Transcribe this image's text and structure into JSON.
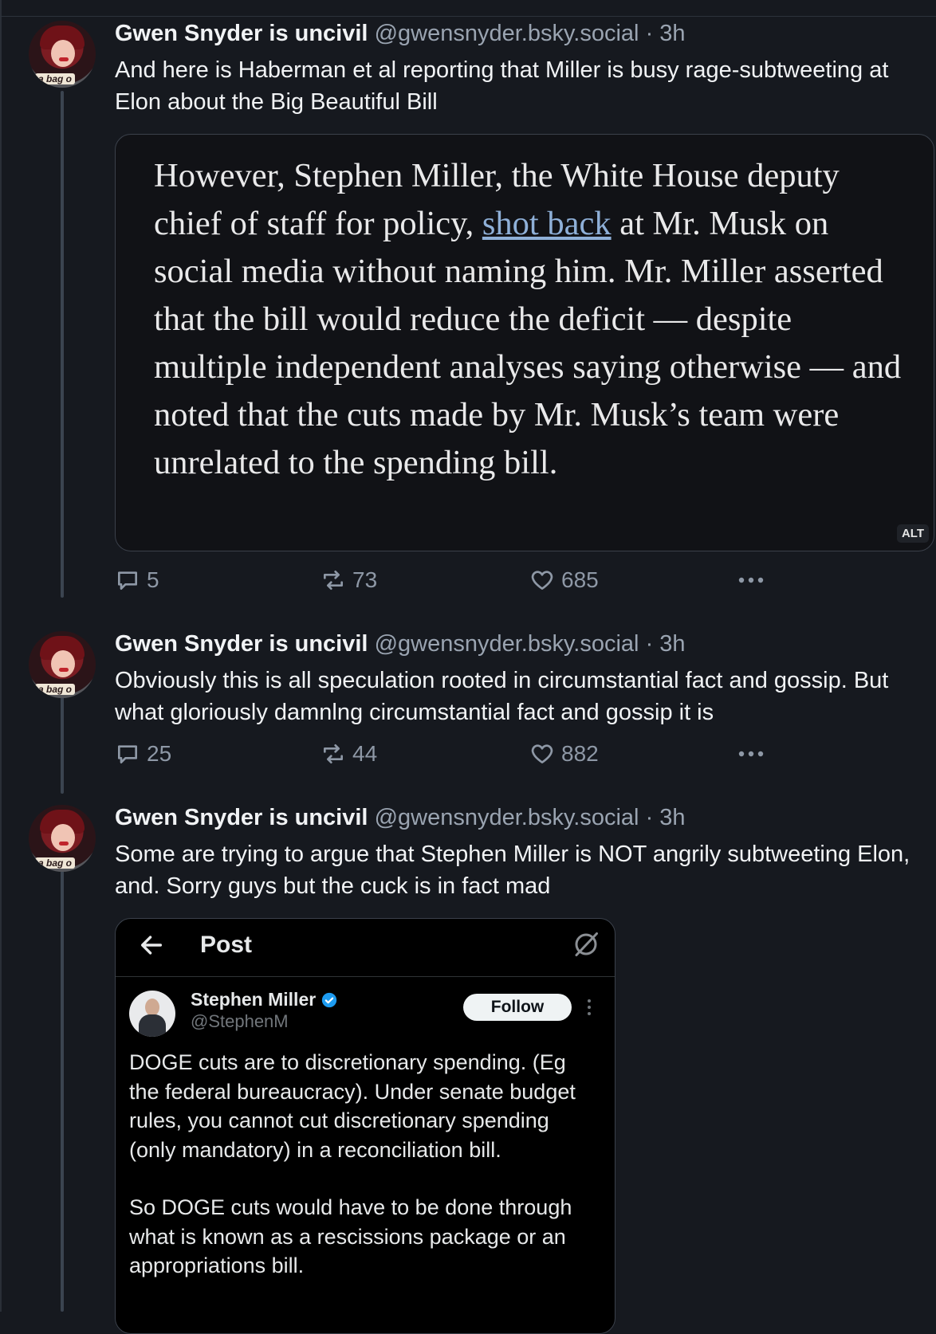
{
  "posts": [
    {
      "author_name": "Gwen Snyder is uncivil",
      "handle": "@gwensnyder.bsky.social",
      "time": "· 3h",
      "avatar_tag": "a bag o",
      "text": "And here is Haberman et al reporting that Miller is busy rage-subtweeting at Elon about the Big Beautiful Bill",
      "embed": {
        "type": "image",
        "quote_before": "However, Stephen Miller, the White House deputy chief of staff for policy, ",
        "quote_link": "shot back",
        "quote_after": " at Mr. Musk on social media without naming him. Mr. Miller asserted that the bill would reduce the deficit — despite multiple independent analyses saying otherwise — and noted that the cuts made by Mr. Musk’s team were unrelated to the spending bill.",
        "alt_badge": "ALT"
      },
      "replies": "5",
      "reposts": "73",
      "likes": "685"
    },
    {
      "author_name": "Gwen Snyder is uncivil",
      "handle": "@gwensnyder.bsky.social",
      "time": "· 3h",
      "avatar_tag": "a bag o",
      "text": "Obviously this is all speculation rooted in circumstantial fact and gossip. But what gloriously damnlng circumstantial fact and gossip it is",
      "replies": "25",
      "reposts": "44",
      "likes": "882"
    },
    {
      "author_name": "Gwen Snyder is uncivil",
      "handle": "@gwensnyder.bsky.social",
      "time": "· 3h",
      "avatar_tag": "a bag o",
      "text": "Some are trying to argue that Stephen Miller is NOT angrily subtweeting Elon, and. Sorry guys but the cuck is in fact mad",
      "embed": {
        "type": "screenshot",
        "header_title": "Post",
        "name": "Stephen Miller",
        "handle": "@StephenM",
        "follow_label": "Follow",
        "paragraphs": [
          "DOGE cuts are to discretionary spending. (Eg the federal bureaucracy). Under senate budget rules, you cannot cut discretionary spending (only mandatory) in a reconciliation bill.",
          "So DOGE cuts would have to be done through what is known as a rescissions package or an appropriations bill."
        ]
      }
    }
  ],
  "colors": {
    "background": "#16191f",
    "text": "#f1f3f5",
    "muted": "#9aa4b1",
    "link": "#8fb0d8",
    "thread_line": "#3b4450",
    "verified": "#1d9bf0"
  },
  "icons": [
    "reply-icon",
    "repost-icon",
    "like-icon",
    "more-icon",
    "back-arrow-icon",
    "grok-icon",
    "verified-badge-icon"
  ]
}
